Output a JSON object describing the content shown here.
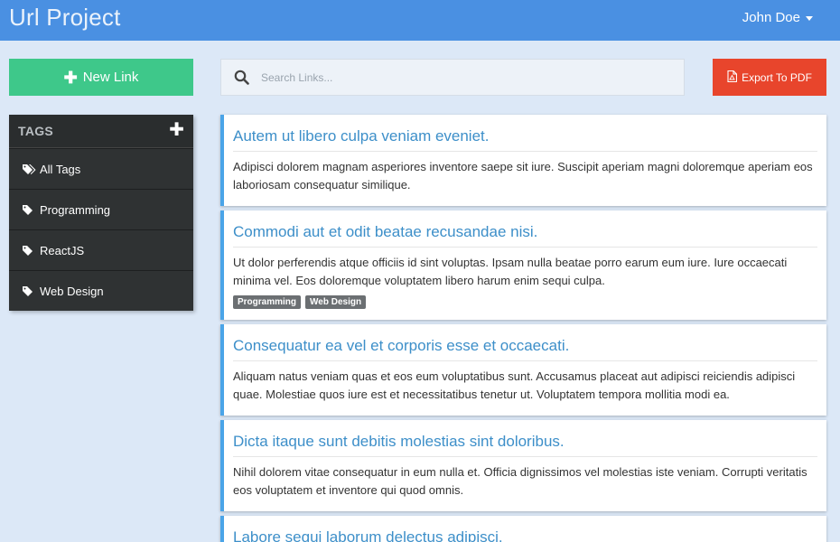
{
  "navbar": {
    "brand": "Url Project",
    "user_name": "John Doe"
  },
  "sidebar": {
    "new_link_label": "New Link",
    "tags_title": "TAGS",
    "items": [
      {
        "label": "All Tags",
        "icon": "tags-icon"
      },
      {
        "label": "Programming",
        "icon": "tag-icon"
      },
      {
        "label": "ReactJS",
        "icon": "tag-icon"
      },
      {
        "label": "Web Design",
        "icon": "tag-icon"
      }
    ]
  },
  "search": {
    "placeholder": "Search Links...",
    "value": ""
  },
  "toolbar": {
    "export_label": "Export To PDF"
  },
  "links": [
    {
      "title": "Autem ut libero culpa veniam eveniet.",
      "description": "Adipisci dolorem magnam asperiores inventore saepe sit iure. Suscipit aperiam magni doloremque aperiam eos laboriosam consequatur similique.",
      "tags": []
    },
    {
      "title": "Commodi aut et odit beatae recusandae nisi.",
      "description": "Ut dolor perferendis atque officiis id sint voluptas. Ipsam nulla beatae porro earum eum iure. Iure occaecati minima vel. Eos doloremque voluptatem libero harum enim sequi culpa.",
      "tags": [
        "Programming",
        "Web Design"
      ]
    },
    {
      "title": "Consequatur ea vel et corporis esse et occaecati.",
      "description": "Aliquam natus veniam quas et eos eum voluptatibus sunt. Accusamus placeat aut adipisci reiciendis adipisci quae. Molestiae quos iure est et necessitatibus tenetur ut. Voluptatem tempora mollitia modi ea.",
      "tags": []
    },
    {
      "title": "Dicta itaque sunt debitis molestias sint doloribus.",
      "description": "Nihil dolorem vitae consequatur in eum nulla et. Officia dignissimos vel molestias iste veniam. Corrupti veritatis eos voluptatem et inventore qui quod omnis.",
      "tags": []
    },
    {
      "title": "Labore sequi laborum delectus adipisci.",
      "description": "",
      "tags": []
    }
  ],
  "colors": {
    "navbar": "#4a90e2",
    "new_link_button": "#3ec88a",
    "export_button": "#e8452c",
    "link_title": "#3d8fc9",
    "card_accent": "#4aa4e8"
  }
}
